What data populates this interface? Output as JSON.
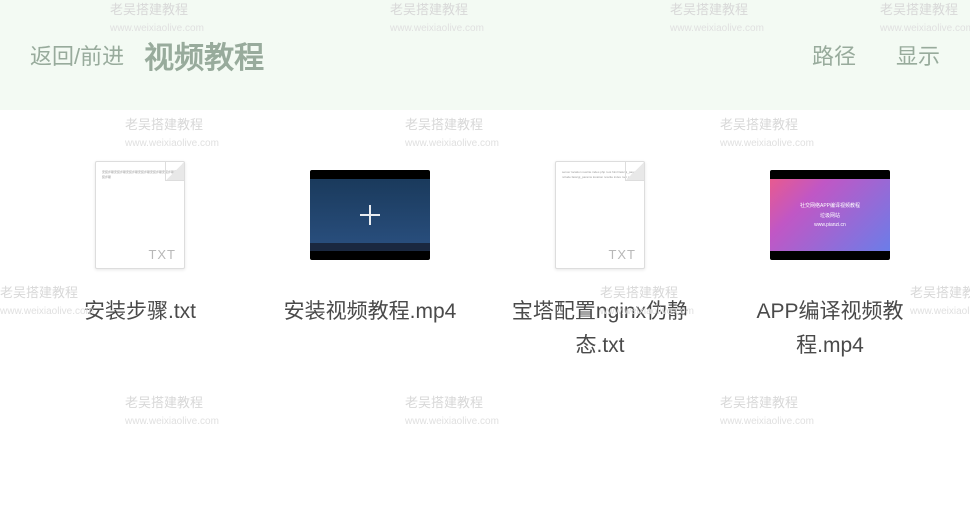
{
  "header": {
    "nav_back_forward": "返回/前进",
    "title": "视频教程",
    "action_path": "路径",
    "action_display": "显示"
  },
  "files": [
    {
      "name": "安装步骤.txt",
      "type": "txt",
      "ext_label": "TXT"
    },
    {
      "name": "安装视频教程.mp4",
      "type": "video-desktop"
    },
    {
      "name": "宝塔配置nginx伪静态.txt",
      "type": "txt",
      "ext_label": "TXT"
    },
    {
      "name": "APP编译视频教程.mp4",
      "type": "video-app"
    }
  ],
  "watermark": {
    "line1": "老吴搭建教程",
    "line2": "www.weixiaolive.com"
  },
  "thumb_text": {
    "app_line1": "社交网络APP编译视频教程",
    "app_line2": "垃圾网站",
    "app_line3": "www.pianzi.cn"
  }
}
